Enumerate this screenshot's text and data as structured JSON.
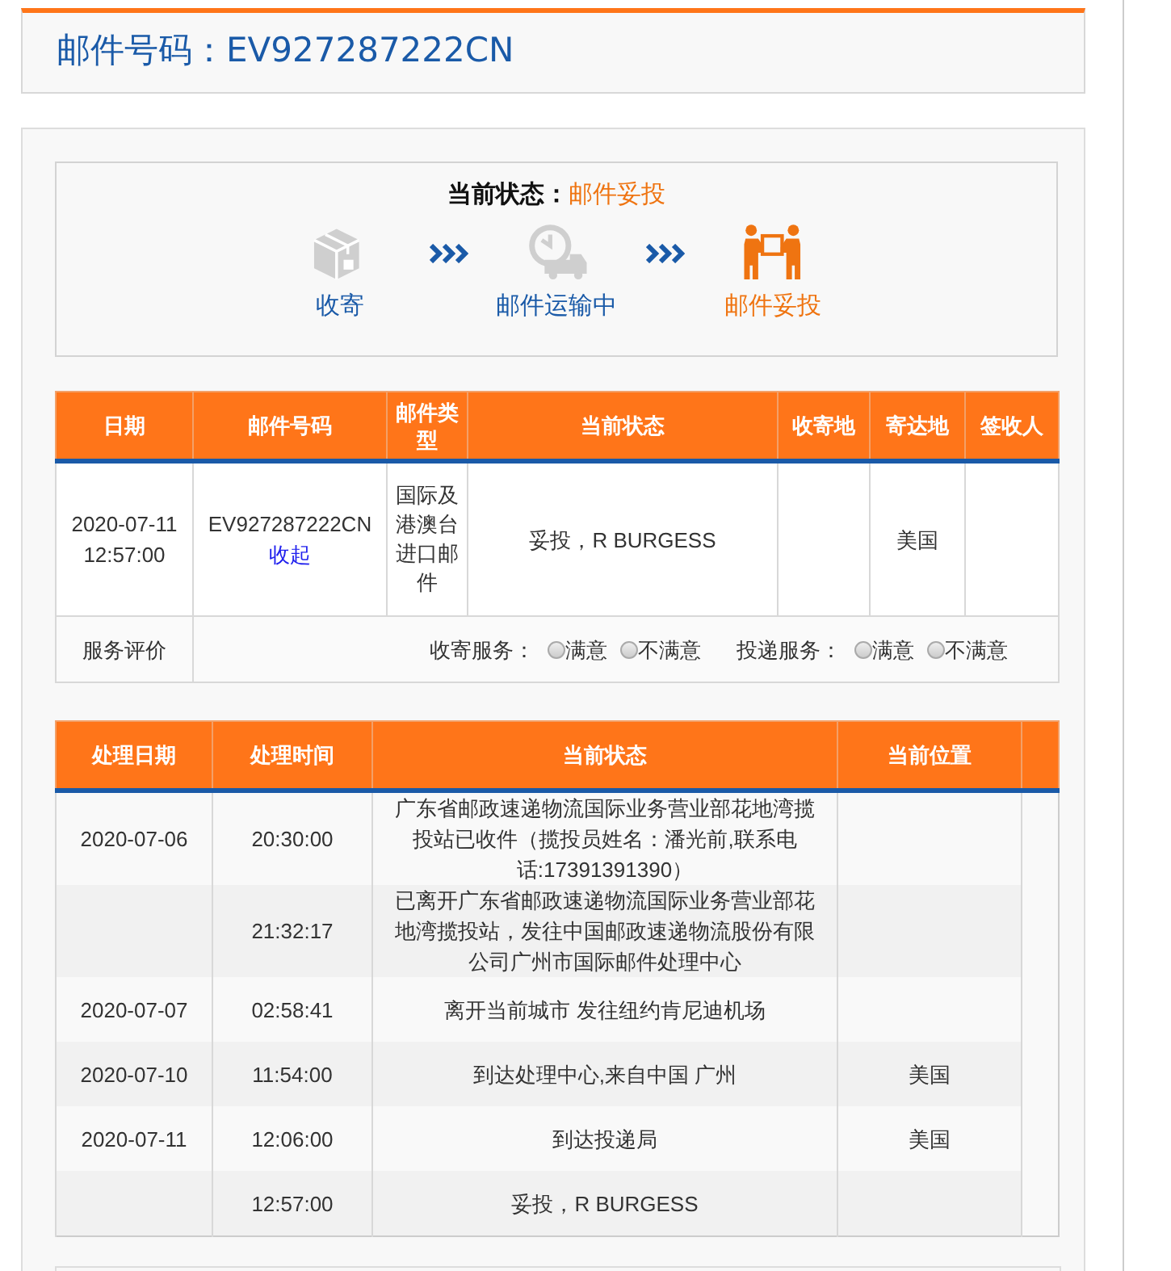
{
  "header": {
    "title": "邮件号码：EV927287222CN"
  },
  "status": {
    "label": "当前状态：",
    "value": "邮件妥投",
    "steps": [
      {
        "kind": "box",
        "label": "收寄",
        "current": false
      },
      {
        "kind": "transit",
        "label": "邮件运输中",
        "current": false
      },
      {
        "kind": "delivery",
        "label": "邮件妥投",
        "current": true
      }
    ]
  },
  "summary_table": {
    "columns": [
      "日期",
      "邮件号码",
      "邮件类型",
      "当前状态",
      "收寄地",
      "寄达地",
      "签收人"
    ],
    "row": {
      "date": "2020-07-11 12:57:00",
      "mail_number": "EV927287222CN",
      "collapse_link": "收起",
      "mail_type": "国际及港澳台进口邮件",
      "status": "妥投，R BURGESS",
      "destination": "美国"
    },
    "rating": {
      "label": "服务评价",
      "groups": [
        {
          "label": "收寄服务：",
          "options": [
            {
              "label": "满意",
              "checked": false
            },
            {
              "label": "不满意",
              "checked": false
            }
          ]
        },
        {
          "label": "投递服务：",
          "options": [
            {
              "label": "满意",
              "checked": false
            },
            {
              "label": "不满意",
              "checked": false
            }
          ]
        }
      ]
    }
  },
  "history_table": {
    "columns": [
      "处理日期",
      "处理时间",
      "当前状态",
      "当前位置"
    ],
    "rows": [
      {
        "date": "2020-07-06",
        "time": "20:30:00",
        "status": "广东省邮政速递物流国际业务营业部花地湾揽投站已收件（揽投员姓名：潘光前,联系电话:17391391390）"
      },
      {
        "time": "21:32:17",
        "status": "已离开广东省邮政速递物流国际业务营业部花地湾揽投站，发往中国邮政速递物流股份有限公司广州市国际邮件处理中心"
      },
      {
        "date": "2020-07-07",
        "time": "02:58:41",
        "status": "离开当前城市 发往纽约肯尼迪机场"
      },
      {
        "date": "2020-07-10",
        "time": "11:54:00",
        "status": "到达处理中心,来自中国 广州",
        "location": "美国"
      },
      {
        "date": "2020-07-11",
        "time": "12:06:00",
        "status": "到达投递局",
        "location": "美国"
      },
      {
        "time": "12:57:00",
        "status": "妥投，R BURGESS"
      }
    ]
  }
}
